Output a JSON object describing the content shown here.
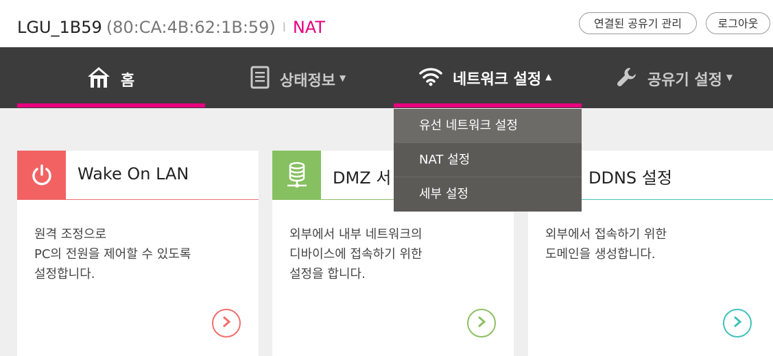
{
  "header": {
    "device_name": "LGU_1B59",
    "mac": "(80:CA:4B:62:1B:59)",
    "separator": "l",
    "mode": "NAT",
    "manage_button": "연결된 공유기 관리",
    "logout_button": "로그아웃"
  },
  "nav": {
    "home": "홈",
    "status": "상태정보",
    "network": "네트워크 설정",
    "router": "공유기 설정",
    "caret_down": "▼",
    "caret_up": "▲"
  },
  "dropdown": {
    "items": [
      "유선 네트워크 설정",
      "NAT 설정",
      "세부 설정"
    ]
  },
  "cards": [
    {
      "title": "Wake On LAN",
      "desc": [
        "원격 조정으로",
        "PC의 전원을 제어할 수 있도록",
        "설정합니다."
      ],
      "color": "#f26262",
      "icon": "power-icon"
    },
    {
      "title": "DMZ 서",
      "desc": [
        "외부에서 내부 네트워크의",
        "디바이스에 접속하기 위한",
        "설정을 합니다."
      ],
      "color": "#86c060",
      "icon": "server-icon"
    },
    {
      "title": "DDNS 설정",
      "desc": [
        "외부에서 접속하기 위한",
        "도메인을 생성합니다."
      ],
      "color": "#37bdb1",
      "icon": "globe-icon"
    }
  ],
  "colors": {
    "accent": "#e6007e",
    "nav_bg": "#3c3c3c",
    "dropdown_bg": "#5c5a57"
  }
}
